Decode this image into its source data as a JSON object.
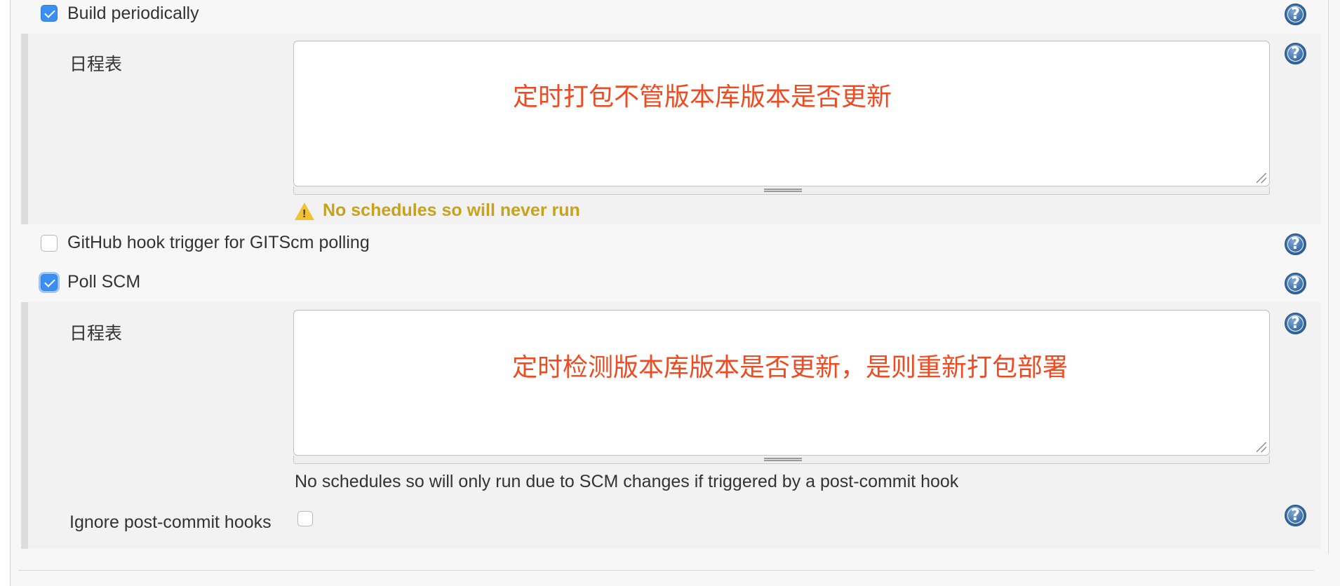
{
  "triggers": {
    "build_periodically": {
      "label": "Build periodically",
      "checked": true
    },
    "github_hook": {
      "label": "GitHub hook trigger for GITScm polling",
      "checked": false
    },
    "poll_scm": {
      "label": "Poll SCM",
      "checked": true
    }
  },
  "build_periodically_section": {
    "schedule_label": "日程表",
    "schedule_value": "",
    "annotation": "定时打包不管版本库版本是否更新",
    "warning": "No schedules so will never run"
  },
  "poll_scm_section": {
    "schedule_label": "日程表",
    "schedule_value": "",
    "annotation": "定时检测版本库版本是否更新，是则重新打包部署",
    "info": "No schedules so will only run due to SCM changes if triggered by a post-commit hook",
    "ignore_hooks_label": "Ignore post-commit hooks",
    "ignore_hooks_checked": false
  },
  "help_icon_glyph": "?",
  "colors": {
    "annotation_red": "#ef4b23",
    "warning_text": "#c7a21c",
    "checkbox_blue": "#3b8ff0",
    "help_blue": "#3a6ea8"
  }
}
